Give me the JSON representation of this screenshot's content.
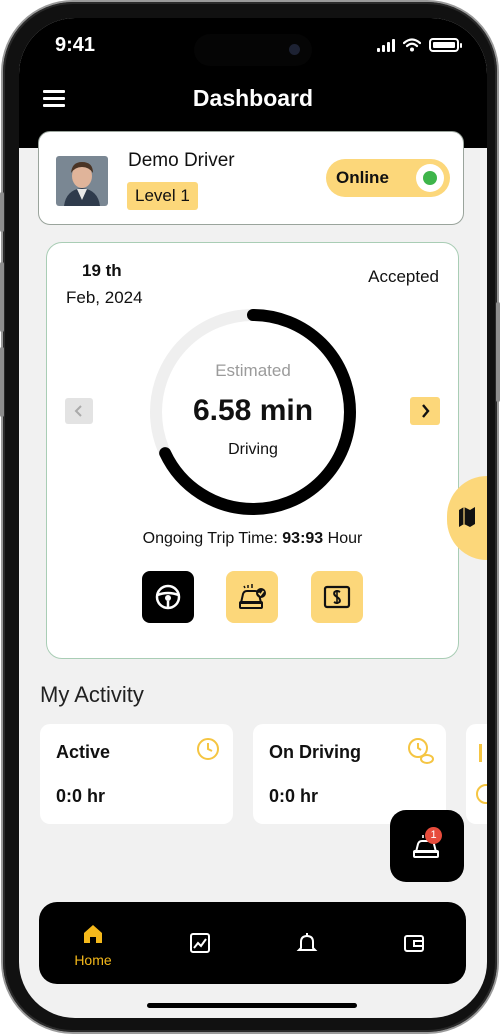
{
  "status_bar": {
    "time": "9:41"
  },
  "header": {
    "title": "Dashboard",
    "menu_icon": "menu-icon"
  },
  "profile": {
    "name": "Demo Driver",
    "level": "Level 1",
    "status_label": "Online",
    "online": true
  },
  "trip": {
    "date_day": "19 th",
    "date_month": "Feb, 2024",
    "status": "Accepted",
    "progress_fraction": 0.68,
    "estimate_label": "Estimated",
    "estimate_value": "6.58 min",
    "mode": "Driving",
    "ongoing_label": "Ongoing Trip Time:",
    "ongoing_value": "93:93",
    "ongoing_unit": "Hour",
    "actions": [
      {
        "icon": "steering-wheel-icon",
        "active": true
      },
      {
        "icon": "car-check-icon",
        "active": false
      },
      {
        "icon": "cash-icon",
        "active": false
      }
    ]
  },
  "activity": {
    "title": "My Activity",
    "cards": [
      {
        "title": "Active",
        "value": "0:0 hr",
        "icon": "clock-icon"
      },
      {
        "title": "On Driving",
        "value": "0:0 hr",
        "icon": "clock-money-icon"
      }
    ]
  },
  "fab": {
    "badge": "1",
    "icon": "car-request-icon"
  },
  "bottom_nav": {
    "items": [
      {
        "label": "Home",
        "icon": "home-icon",
        "active": true
      },
      {
        "label": "",
        "icon": "chart-icon",
        "active": false
      },
      {
        "label": "",
        "icon": "bell-icon",
        "active": false
      },
      {
        "label": "",
        "icon": "wallet-icon",
        "active": false
      }
    ]
  },
  "colors": {
    "accent": "#fcd77a",
    "accent_text": "#f5b91b",
    "online_dot": "#3eb54a",
    "badge": "#e74c3c",
    "background": "#f1f1f1"
  }
}
